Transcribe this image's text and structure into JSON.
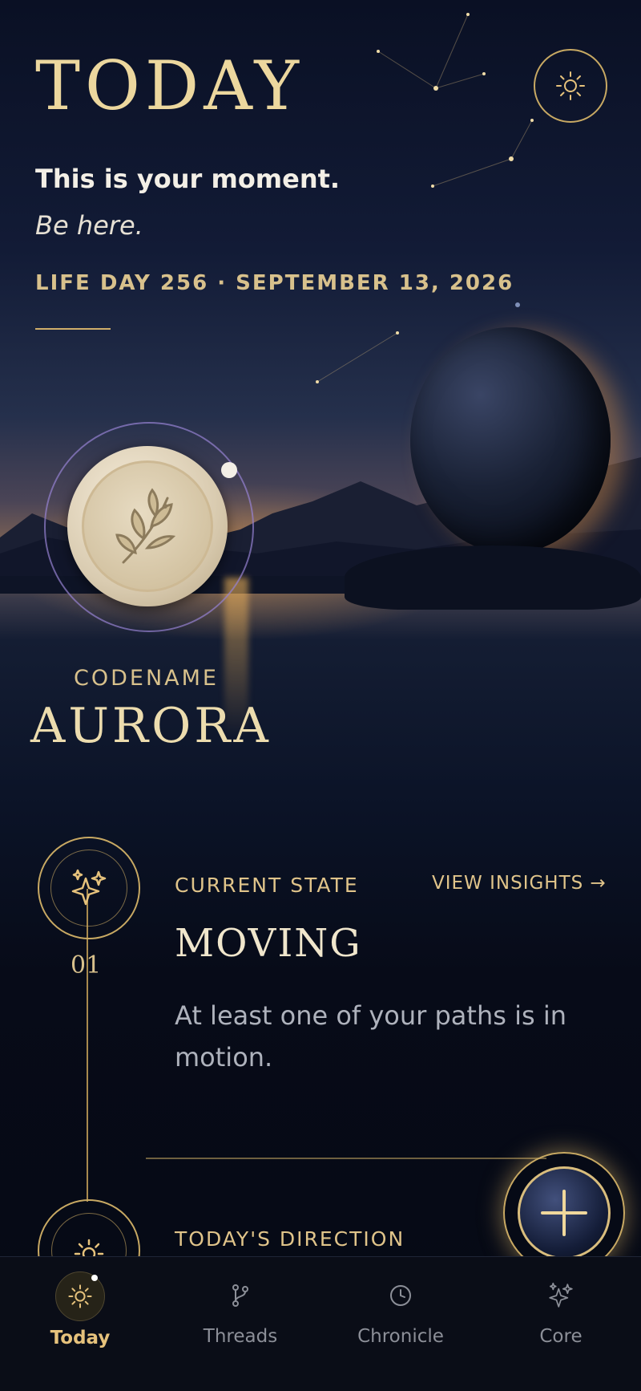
{
  "header": {
    "title": "TODAY",
    "tagline": "This is your moment.",
    "tagline_emphasis": "Be here.",
    "dateline": "LIFE DAY 256 · SEPTEMBER 13, 2026",
    "settings_icon": "sun-icon"
  },
  "identity": {
    "codename_label": "CODENAME",
    "codename": "AURORA",
    "seal_icon": "leaf-seal"
  },
  "current_state": {
    "step": "01",
    "label": "CURRENT STATE",
    "link": "VIEW INSIGHTS →",
    "value": "MOVING",
    "description": "At least one of your paths is in motion.",
    "icon": "sparkles-icon"
  },
  "direction": {
    "label": "TODAY'S DIRECTION",
    "icon": "sun-icon"
  },
  "fab": {
    "icon": "plus-icon"
  },
  "nav": {
    "items": [
      {
        "label": "Today",
        "icon": "sun-icon",
        "active": true
      },
      {
        "label": "Threads",
        "icon": "branch-icon"
      },
      {
        "label": "Chronicle",
        "icon": "clock-icon"
      },
      {
        "label": "Core",
        "icon": "sparkles-icon"
      }
    ]
  },
  "colors": {
    "accent_gold": "#e6c27c",
    "background": "#070b18",
    "muted_text": "#aeb2bc"
  }
}
